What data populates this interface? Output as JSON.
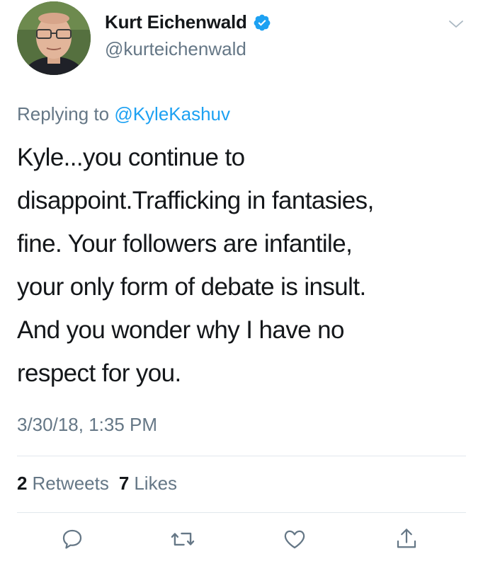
{
  "tweet": {
    "author": {
      "display_name": "Kurt Eichenwald",
      "handle": "@kurteichenwald",
      "verified": true
    },
    "reply": {
      "prefix": "Replying to",
      "mention": "@KyleKashuv"
    },
    "text_lines": [
      "Kyle...you continue to",
      "disappoint.Trafficking in fantasies,",
      "fine. Your followers are infantile,",
      "your only form of debate is insult.",
      "And you wonder why I have no",
      "respect for you."
    ],
    "timestamp": "3/30/18, 1:35 PM",
    "stats": {
      "retweets_count": "2",
      "retweets_label": "Retweets",
      "likes_count": "7",
      "likes_label": "Likes"
    }
  },
  "icons": {
    "verified": "verified-badge-icon",
    "caret": "chevron-down-icon",
    "reply": "reply-icon",
    "retweet": "retweet-icon",
    "like": "heart-icon",
    "share": "share-icon"
  },
  "colors": {
    "accent": "#1da1f2",
    "secondary_text": "#657786",
    "primary_text": "#14171a",
    "divider": "#e1e8ed"
  }
}
